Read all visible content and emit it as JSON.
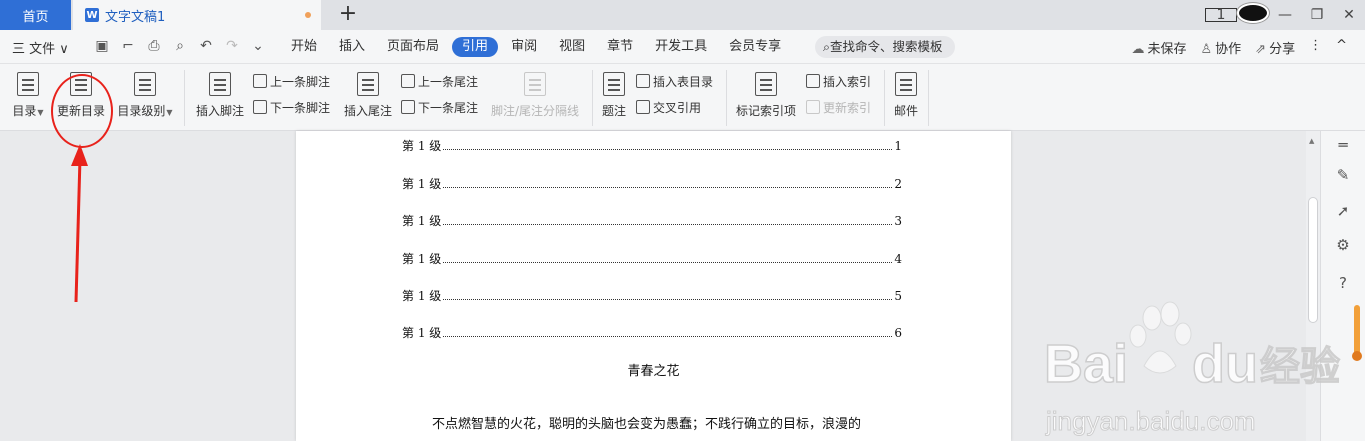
{
  "tabs": {
    "home": "首页",
    "doc": "文字文稿1",
    "doc_badge": "W",
    "new_tab": "+"
  },
  "window": {
    "badge": "1",
    "minimize": "—",
    "restore": "❐",
    "close": "✕"
  },
  "menu": {
    "file": "三 文件 ∨",
    "tabs": [
      "开始",
      "插入",
      "页面布局",
      "引用",
      "审阅",
      "视图",
      "章节",
      "开发工具",
      "会员专享"
    ],
    "active_tab": "引用",
    "search": "查找命令、搜索模板",
    "right": {
      "unsaved": "未保存",
      "collaborate": "协作",
      "share": "分享",
      "more": "⋮",
      "collapse": "^"
    }
  },
  "ribbon": {
    "toc": "目录",
    "update_toc": "更新目录",
    "toc_level": "目录级别",
    "insert_footnote": "插入脚注",
    "prev_footnote": "上一条脚注",
    "next_footnote": "下一条脚注",
    "insert_endnote": "插入尾注",
    "prev_endnote": "上一条尾注",
    "next_endnote": "下一条尾注",
    "separator": "脚注/尾注分隔线",
    "caption": "题注",
    "insert_table_toc": "插入表目录",
    "cross_ref": "交叉引用",
    "mark_index": "标记索引项",
    "insert_index": "插入索引",
    "update_index": "更新索引",
    "mail": "邮件"
  },
  "document": {
    "toc_entries": [
      {
        "label": "第 1 级",
        "page": "1"
      },
      {
        "label": "第 1 级",
        "page": "2"
      },
      {
        "label": "第 1 级",
        "page": "3"
      },
      {
        "label": "第 1 级",
        "page": "4"
      },
      {
        "label": "第 1 级",
        "page": "5"
      },
      {
        "label": "第 1 级",
        "page": "6"
      }
    ],
    "title": "青春之花",
    "paragraph": "不点燃智慧的火花，聪明的头脑也会变为愚蠢；不践行确立的目标，浪漫的"
  },
  "watermark": {
    "brand_latin": "Bai",
    "brand_du": "du",
    "brand_cn": "经验",
    "url": "jingyan.baidu.com"
  },
  "colors": {
    "accent": "#2f6fd6",
    "annotation": "#e8221b"
  }
}
